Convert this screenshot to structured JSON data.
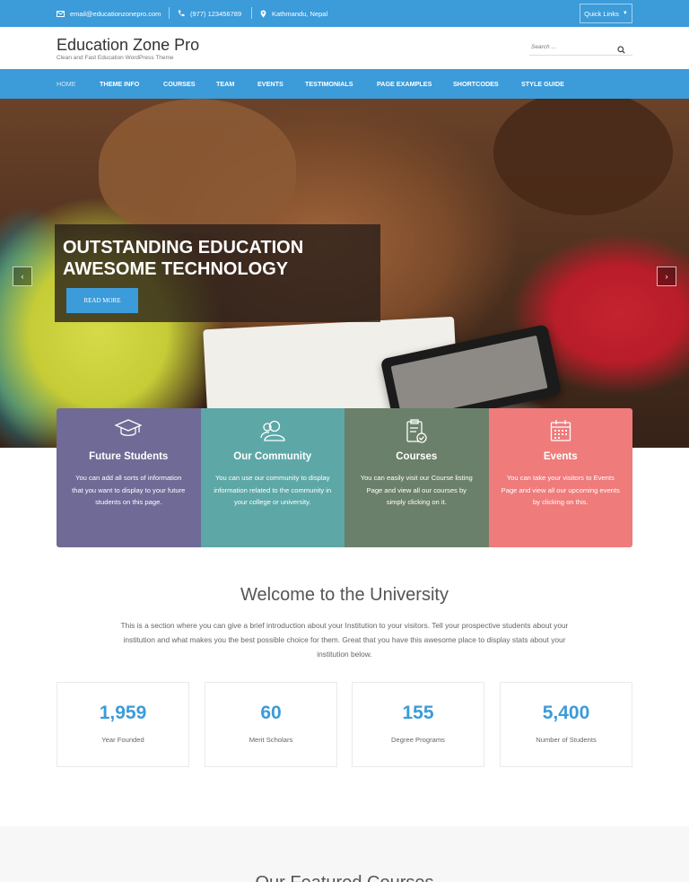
{
  "topbar": {
    "email": "email@educationzonepro.com",
    "phone": "(977) 123456789",
    "address": "Kathmandu, Nepal",
    "quick_links": "Quick Links"
  },
  "header": {
    "site_title": "Education Zone Pro",
    "tagline": "Clean and Fast Education WordPress Theme",
    "search_placeholder": "Search ..."
  },
  "nav": {
    "items": [
      "HOME",
      "THEME INFO",
      "COURSES",
      "TEAM",
      "EVENTS",
      "TESTIMONIALS",
      "PAGE EXAMPLES",
      "SHORTCODES",
      "STYLE GUIDE"
    ],
    "active_index": 0
  },
  "hero": {
    "title": "OUTSTANDING EDUCATION\nAWESOME TECHNOLOGY",
    "button": "READ MORE",
    "prev": "‹",
    "next": "›"
  },
  "features": [
    {
      "icon": "graduation-cap-icon",
      "title": "Future Students",
      "text": "You can add all sorts of information that you want to display to your future students on this page.",
      "color": "#6f6a96"
    },
    {
      "icon": "community-icon",
      "title": "Our Community",
      "text": "You can use our community to display information related to the community in your college or university.",
      "color": "#5da8a7"
    },
    {
      "icon": "clipboard-check-icon",
      "title": "Courses",
      "text": "You can easily visit our Course listing Page and view all our courses by simply clicking on it.",
      "color": "#6b806a"
    },
    {
      "icon": "calendar-icon",
      "title": "Events",
      "text": "You can take your visitors to Events Page and view all our upcoming events by clicking on this.",
      "color": "#ef7b7b"
    }
  ],
  "welcome": {
    "title": "Welcome to the University",
    "text": "This is a section where you can give a brief introduction about your Institution to your visitors. Tell your prospective students about your institution and what makes you the best possible choice for them. Great that you have this awesome place to display stats about your institution below."
  },
  "stats": [
    {
      "value": "1,959",
      "label": "Year Founded"
    },
    {
      "value": "60",
      "label": "Merit Scholars"
    },
    {
      "value": "155",
      "label": "Degree Programs"
    },
    {
      "value": "5,400",
      "label": "Number of Students"
    }
  ],
  "next_section_title": "Our Featured Courses",
  "colors": {
    "accent": "#3c9bd9"
  }
}
